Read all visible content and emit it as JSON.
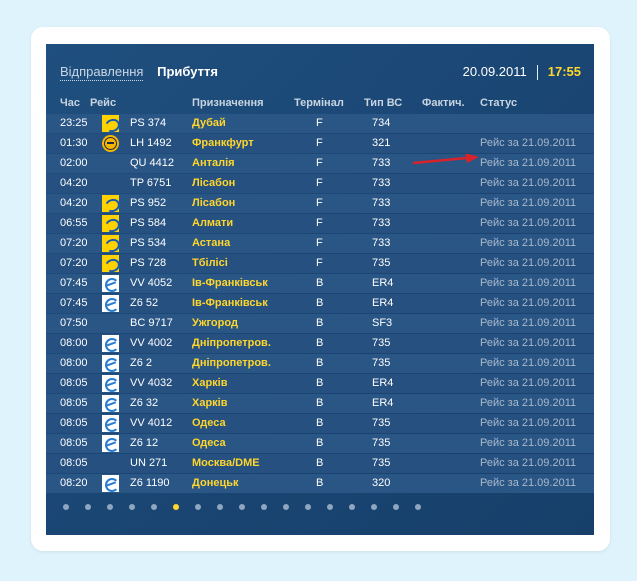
{
  "tabs": {
    "departures": "Відправлення",
    "arrivals": "Прибуття"
  },
  "date": "20.09.2011",
  "time": "17:55",
  "headers": {
    "time": "Час",
    "flight": "Рейс",
    "destination": "Призначення",
    "terminal": "Термінал",
    "aircraft": "Тип ВС",
    "actual": "Фактич.",
    "status": "Статус"
  },
  "colors": {
    "accent": "#ffd62b",
    "board": "#1f4f7e",
    "status": "#a9b8c9",
    "arrow": "#d8232a"
  },
  "rows": [
    {
      "time": "23:25",
      "logo": "mau-icon",
      "flight": "PS 374",
      "dest": "Дубай",
      "term": "F",
      "type": "734",
      "status": ""
    },
    {
      "time": "01:30",
      "logo": "lufthansa-icon",
      "flight": "LH 1492",
      "dest": "Франкфурт",
      "term": "F",
      "type": "321",
      "status": "Рейс за 21.09.2011"
    },
    {
      "time": "02:00",
      "logo": "",
      "flight": "QU 4412",
      "dest": "Анталія",
      "term": "F",
      "type": "733",
      "status": "Рейс за 21.09.2011"
    },
    {
      "time": "04:20",
      "logo": "",
      "flight": "TP 6751",
      "dest": "Лісабон",
      "term": "F",
      "type": "733",
      "status": "Рейс за 21.09.2011"
    },
    {
      "time": "04:20",
      "logo": "mau-icon",
      "flight": "PS 952",
      "dest": "Лісабон",
      "term": "F",
      "type": "733",
      "status": "Рейс за 21.09.2011"
    },
    {
      "time": "06:55",
      "logo": "mau-icon",
      "flight": "PS 584",
      "dest": "Алмати",
      "term": "F",
      "type": "733",
      "status": "Рейс за 21.09.2011"
    },
    {
      "time": "07:20",
      "logo": "mau-icon",
      "flight": "PS 534",
      "dest": "Астана",
      "term": "F",
      "type": "733",
      "status": "Рейс за 21.09.2011"
    },
    {
      "time": "07:20",
      "logo": "mau-icon",
      "flight": "PS 728",
      "dest": "Тбілісі",
      "term": "F",
      "type": "735",
      "status": "Рейс за 21.09.2011"
    },
    {
      "time": "07:45",
      "logo": "aerosvit-icon",
      "flight": "VV 4052",
      "dest": "Ів-Франківськ",
      "term": "B",
      "type": "ER4",
      "status": "Рейс за 21.09.2011"
    },
    {
      "time": "07:45",
      "logo": "aerosvit-icon",
      "flight": "Z6 52",
      "dest": "Ів-Франківськ",
      "term": "B",
      "type": "ER4",
      "status": "Рейс за 21.09.2011"
    },
    {
      "time": "07:50",
      "logo": "",
      "flight": "BC 9717",
      "dest": "Ужгород",
      "term": "B",
      "type": "SF3",
      "status": "Рейс за 21.09.2011"
    },
    {
      "time": "08:00",
      "logo": "aerosvit-icon",
      "flight": "VV 4002",
      "dest": "Дніпропетров.",
      "term": "B",
      "type": "735",
      "status": "Рейс за 21.09.2011"
    },
    {
      "time": "08:00",
      "logo": "aerosvit-icon",
      "flight": "Z6 2",
      "dest": "Дніпропетров.",
      "term": "B",
      "type": "735",
      "status": "Рейс за 21.09.2011"
    },
    {
      "time": "08:05",
      "logo": "aerosvit-icon",
      "flight": "VV 4032",
      "dest": "Харків",
      "term": "B",
      "type": "ER4",
      "status": "Рейс за 21.09.2011"
    },
    {
      "time": "08:05",
      "logo": "aerosvit-icon",
      "flight": "Z6 32",
      "dest": "Харків",
      "term": "B",
      "type": "ER4",
      "status": "Рейс за 21.09.2011"
    },
    {
      "time": "08:05",
      "logo": "aerosvit-icon",
      "flight": "VV 4012",
      "dest": "Одеса",
      "term": "B",
      "type": "735",
      "status": "Рейс за 21.09.2011"
    },
    {
      "time": "08:05",
      "logo": "aerosvit-icon",
      "flight": "Z6 12",
      "dest": "Одеса",
      "term": "B",
      "type": "735",
      "status": "Рейс за 21.09.2011"
    },
    {
      "time": "08:05",
      "logo": "",
      "flight": "UN 271",
      "dest": "Москва/DME",
      "term": "B",
      "type": "735",
      "status": "Рейс за 21.09.2011"
    },
    {
      "time": "08:20",
      "logo": "aerosvit-icon",
      "flight": "Z6 1190",
      "dest": "Донецьк",
      "term": "B",
      "type": "320",
      "status": "Рейс за 21.09.2011"
    }
  ],
  "pagination": {
    "count": 17,
    "active": 6
  }
}
